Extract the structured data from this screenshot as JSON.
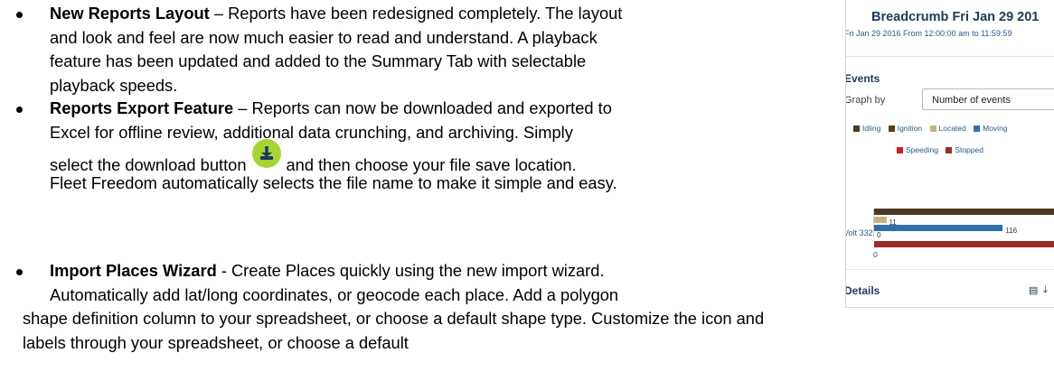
{
  "bullets": [
    {
      "title": "New Reports Layout",
      "lines": [
        " – Reports have been redesigned completely.  The layout",
        "and look and feel are now much easier to read and understand.  A playback",
        "feature has been updated and added to the Summary Tab with selectable",
        "playback speeds."
      ]
    },
    {
      "title": "Reports Export Feature",
      "lines": [
        " – Reports can now be downloaded and exported to",
        "Excel for offline review, additional data crunching, and archiving.  Simply"
      ],
      "select_before": "select the download button",
      "select_after": "and then choose your file save location.",
      "last_line": "Fleet Freedom automatically selects the file name to make it simple and easy."
    },
    {
      "title": "Import Places Wizard",
      "lines": [
        " - Create Places quickly using the new import wizard.",
        "Automatically add lat/long coordinates, or geocode each place.  Add a polygon",
        "shape definition column to your spreadsheet, or choose a default shape type.  Customize the icon and",
        "labels through your spreadsheet, or choose a default"
      ]
    }
  ],
  "download_icon": "download-icon",
  "report": {
    "title": "Breadcrumb Fri Jan 29 201",
    "subtitle": "Fri Jan 29 2016 From 12:00:00 am to 11:59:59",
    "events_heading": "Events",
    "graph_by_label": "Graph by",
    "graph_by_value": "Number of events",
    "legend": [
      {
        "label": "Idling",
        "color": "#4a3a22"
      },
      {
        "label": "Ignition",
        "color": "#5a3f1a"
      },
      {
        "label": "Located",
        "color": "#c9b27a"
      },
      {
        "label": "Moving",
        "color": "#2f6fb0"
      },
      {
        "label": "Speeding",
        "color": "#d01e1e"
      },
      {
        "label": "Stopped",
        "color": "#9a2a2a"
      }
    ],
    "vehicle": "Volt 332",
    "axis_zero": "0",
    "details_heading": "Details"
  },
  "chart_data": {
    "type": "bar",
    "categories": [
      "Volt 332"
    ],
    "series": [
      {
        "name": "Idling",
        "values": [
          null
        ]
      },
      {
        "name": "Ignition",
        "values": [
          11
        ]
      },
      {
        "name": "Moving",
        "values": [
          116
        ]
      },
      {
        "name": "Located",
        "values": [
          0
        ]
      },
      {
        "name": "Stopped",
        "values": [
          220
        ]
      }
    ],
    "xlim": [
      0,
      220
    ]
  }
}
